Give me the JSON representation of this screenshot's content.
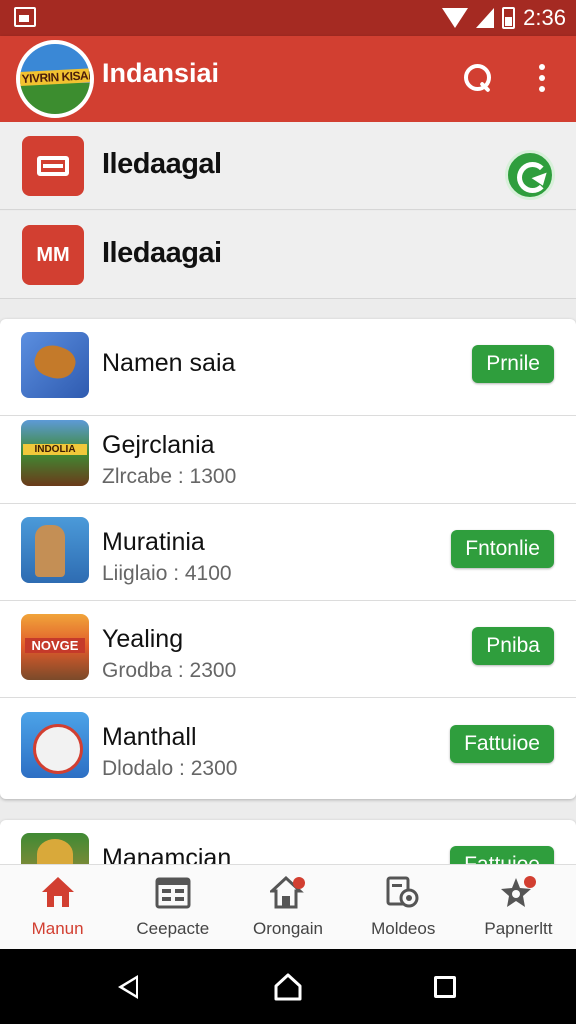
{
  "status_bar": {
    "time": "2:36"
  },
  "app_bar": {
    "title": "Indansiai",
    "logo_text": "YIVRIN KISAN"
  },
  "top_rows": [
    {
      "label": "Iledaagal",
      "icon": "card-icon"
    },
    {
      "label": "Iledaagai",
      "icon_text": "MM"
    }
  ],
  "games": [
    {
      "name": "Namen saia",
      "meta": "",
      "button": "Prnile"
    },
    {
      "name": "Gejrclania",
      "meta": "Zlrcabe : 1300",
      "button": ""
    },
    {
      "name": "Muratinia",
      "meta": "Liiglaio : 4100",
      "button": "Fntonlie"
    },
    {
      "name": "Yealing",
      "meta": "Grodba : 2300",
      "button": "Pniba"
    },
    {
      "name": "Manthall",
      "meta": "Dlodalo : 2300",
      "button": "Fattuioe"
    },
    {
      "name": "Manamcian",
      "meta": "",
      "button": "Fattuioe"
    }
  ],
  "bottom_nav": [
    {
      "label": "Manun",
      "icon": "home-icon",
      "active": true
    },
    {
      "label": "Ceepacte",
      "icon": "calendar-icon"
    },
    {
      "label": "Orongain",
      "icon": "house-badge-icon"
    },
    {
      "label": "Moldeos",
      "icon": "settings-doc-icon"
    },
    {
      "label": "Papnerltt",
      "icon": "star-badge-icon"
    }
  ],
  "colors": {
    "primary": "#d23f31",
    "status_bar": "#a52a22",
    "accent_green": "#2f9e3d"
  }
}
